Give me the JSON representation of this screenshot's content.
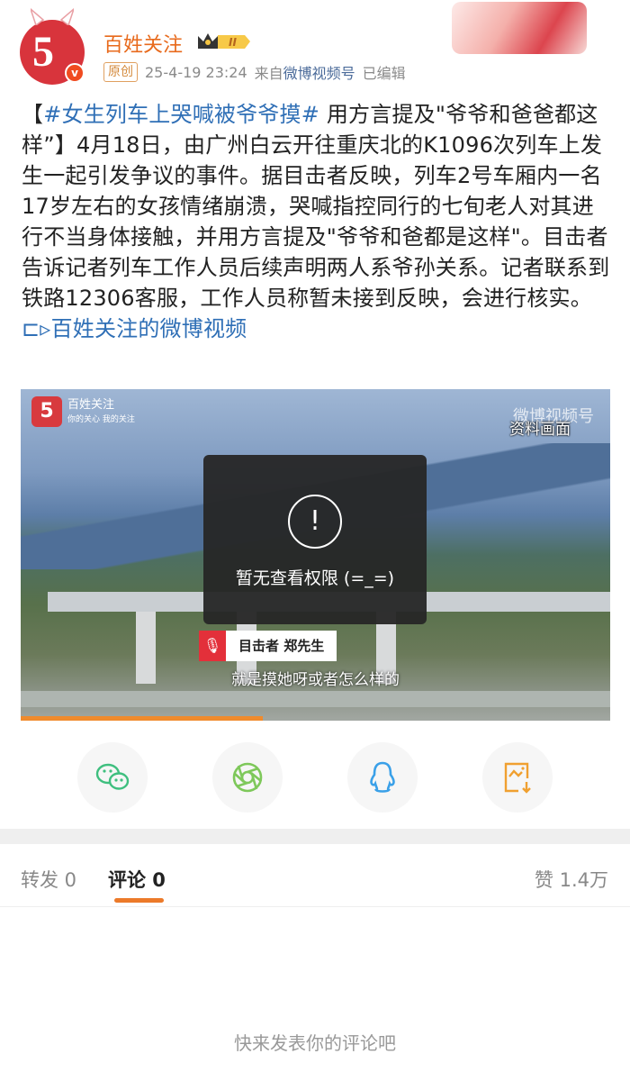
{
  "post": {
    "author": "百姓关注",
    "level_badge": "II",
    "original_tag": "原创",
    "time": "25-4-19 23:24",
    "from_prefix": "来自",
    "source": "微博视频号",
    "edited": "已编辑",
    "hashtag": "#女生列车上哭喊被爷爷摸#",
    "text": " 用方言提及\"爷爷和爸爸都这样”】4月18日，由广州白云开往重庆北的K1096次列车上发生一起引发争议的事件。据目击者反映，列车2号车厢内一名17岁左右的女孩情绪崩溃，哭喊指控同行的七旬老人对其进行不当身体接触，并用方言提及\"爷爷和爸都是这样\"。目击者告诉记者列车工作人员后续声明两人系爷孙关系。记者联系到铁路12306客服，工作人员称暂未接到反映，会进行核实。 ",
    "bracket_open": "【",
    "video_link": "百姓关注的微博视频"
  },
  "video": {
    "logo_name": "百姓关注",
    "logo_slogan": "你的关心 我的关注",
    "watermark": "微博视频号",
    "watermark_sub": "百姓关注",
    "label": "资料画面",
    "no_permission": "暂无查看权限 (=_=)",
    "speaker": "目击者 郑先生",
    "subtitle": "就是摸她呀或者怎么样的",
    "progress_percent": 41
  },
  "share": [
    {
      "icon": "wechat-icon",
      "color": "#3fbf7f"
    },
    {
      "icon": "moments-icon",
      "color": "#7ec85a"
    },
    {
      "icon": "qq-icon",
      "color": "#3aa0e8"
    },
    {
      "icon": "save-image-icon",
      "color": "#f0a030"
    }
  ],
  "tabs": {
    "repost": "转发 0",
    "comment": "评论 0",
    "like": "赞 1.4万"
  },
  "comments_empty": "快来发表你的评论吧",
  "colors": {
    "accent": "#ec7a2a",
    "link": "#2f6fb6",
    "username": "#e86a1c"
  }
}
